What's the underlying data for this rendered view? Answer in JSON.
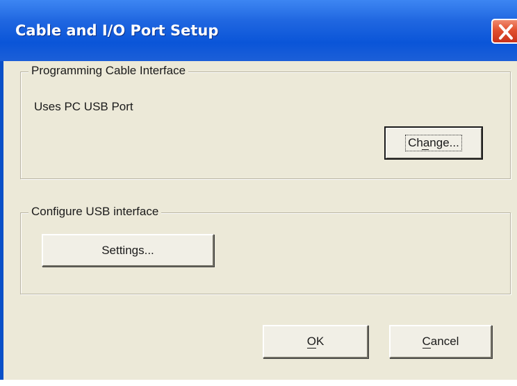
{
  "window": {
    "title": "Cable and I/O Port Setup"
  },
  "programming_cable": {
    "legend": "Programming Cable Interface",
    "status_text": "Uses PC USB Port",
    "change_label": "Change..."
  },
  "usb_config": {
    "legend": "Configure USB interface",
    "settings_label": "Settings..."
  },
  "footer": {
    "ok_label": "OK",
    "cancel_label": "Cancel"
  },
  "icons": {
    "close": "close-icon"
  },
  "colors": {
    "titlebar": "#0a55d8",
    "dialog_face": "#ece9d8",
    "close_button": "#e1502f"
  }
}
